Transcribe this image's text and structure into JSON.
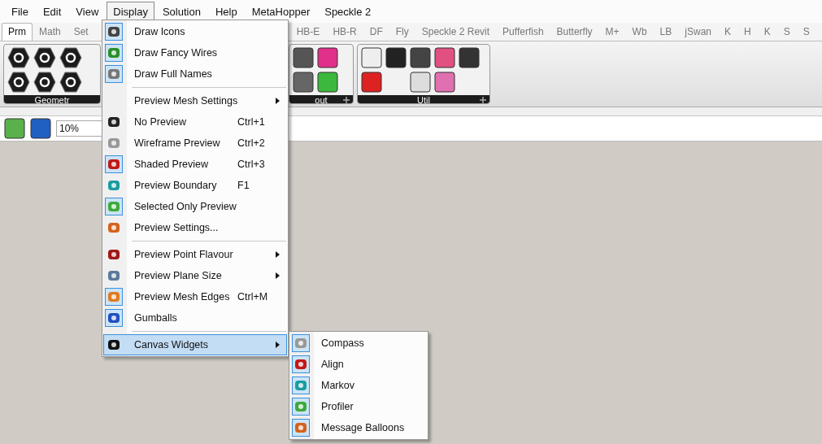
{
  "menu_bar": [
    {
      "label": "File",
      "selected": false
    },
    {
      "label": "Edit",
      "selected": false
    },
    {
      "label": "View",
      "selected": false
    },
    {
      "label": "Display",
      "selected": true
    },
    {
      "label": "Solution",
      "selected": false
    },
    {
      "label": "Help",
      "selected": false
    },
    {
      "label": "MetaHopper",
      "selected": false
    },
    {
      "label": "Speckle 2",
      "selected": false
    }
  ],
  "tabs_left": [
    {
      "label": "Prm",
      "selected": true
    },
    {
      "label": "Math",
      "selected": false
    },
    {
      "label": "Set",
      "selected": false
    }
  ],
  "tabs_right": [
    {
      "label": "HB-E",
      "selected": false
    },
    {
      "label": "HB-R",
      "selected": false
    },
    {
      "label": "DF",
      "selected": false
    },
    {
      "label": "Fly",
      "selected": false
    },
    {
      "label": "Speckle 2 Revit",
      "selected": false
    },
    {
      "label": "Pufferfish",
      "selected": false
    },
    {
      "label": "Butterfly",
      "selected": false
    },
    {
      "label": "M+",
      "selected": false
    },
    {
      "label": "Wb",
      "selected": false
    },
    {
      "label": "LB",
      "selected": false
    },
    {
      "label": "jSwan",
      "selected": false
    },
    {
      "label": "K",
      "selected": false
    },
    {
      "label": "H",
      "selected": false
    },
    {
      "label": "K",
      "selected": false
    },
    {
      "label": "S",
      "selected": false
    },
    {
      "label": "S",
      "selected": false
    }
  ],
  "ribbon_panels": [
    {
      "label": "Geometr"
    },
    {
      "label": "out"
    },
    {
      "label": "Util"
    }
  ],
  "toolbar": {
    "zoom": "10%"
  },
  "display_menu": [
    [
      {
        "kind": "item",
        "label": "Draw Icons",
        "checked": true
      },
      {
        "kind": "item",
        "label": "Draw Fancy Wires",
        "checked": true
      },
      {
        "kind": "item",
        "label": "Draw Full Names",
        "checked": true
      }
    ],
    [
      {
        "kind": "submenu",
        "label": "Preview Mesh Settings",
        "checked": false
      },
      {
        "kind": "item",
        "label": "No Preview",
        "shortcut": "Ctrl+1",
        "checked": false
      },
      {
        "kind": "item",
        "label": "Wireframe Preview",
        "shortcut": "Ctrl+2",
        "checked": false
      },
      {
        "kind": "item",
        "label": "Shaded Preview",
        "shortcut": "Ctrl+3",
        "checked": true
      },
      {
        "kind": "item",
        "label": "Preview Boundary",
        "shortcut": "F1",
        "checked": false
      },
      {
        "kind": "item",
        "label": "Selected Only Preview",
        "checked": true
      },
      {
        "kind": "item",
        "label": "Preview Settings...",
        "checked": false
      }
    ],
    [
      {
        "kind": "submenu",
        "label": "Preview Point Flavour",
        "checked": false
      },
      {
        "kind": "submenu",
        "label": "Preview Plane Size",
        "checked": false
      },
      {
        "kind": "item",
        "label": "Preview Mesh Edges",
        "shortcut": "Ctrl+M",
        "checked": true
      },
      {
        "kind": "item",
        "label": "Gumballs",
        "checked": true
      }
    ],
    [
      {
        "kind": "submenu",
        "label": "Canvas Widgets",
        "checked": false,
        "selected": true
      }
    ]
  ],
  "canvas_widgets_menu": [
    {
      "label": "Compass",
      "checked": true
    },
    {
      "label": "Align",
      "checked": true
    },
    {
      "label": "Markov",
      "checked": true
    },
    {
      "label": "Profiler",
      "checked": true
    },
    {
      "label": "Message Balloons",
      "checked": true
    }
  ]
}
